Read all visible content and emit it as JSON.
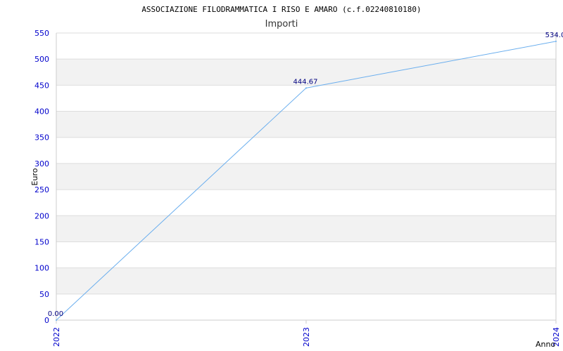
{
  "chart_data": {
    "type": "line",
    "title": "ASSOCIAZIONE FILODRAMMATICA I RISO E AMARO (c.f.02240810180)",
    "subtitle": "Importi",
    "xlabel": "Anno",
    "ylabel": "Euro",
    "categories": [
      "2022",
      "2023",
      "2024"
    ],
    "series": [
      {
        "values": [
          0.0,
          444.67,
          534.0
        ]
      }
    ],
    "data_labels": [
      "0.00",
      "444.67",
      "534.0"
    ],
    "ylim": [
      0,
      550
    ],
    "yticks": [
      0,
      50,
      100,
      150,
      200,
      250,
      300,
      350,
      400,
      450,
      500,
      550
    ],
    "grid": true,
    "colors": {
      "line": "#6aaeee",
      "tick_text": "#0000cc",
      "data_label": "#000080",
      "band": "#f2f2f2",
      "grid": "#dddddd",
      "axis": "#cccccc"
    }
  }
}
